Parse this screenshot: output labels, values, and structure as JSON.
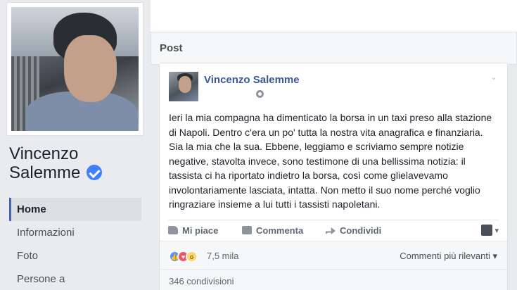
{
  "profile": {
    "name_line1": "Vincenzo",
    "name_line2": "Salemme",
    "verified_icon": "verified-badge-icon"
  },
  "nav": [
    {
      "label": "Home",
      "active": true
    },
    {
      "label": "Informazioni"
    },
    {
      "label": "Foto"
    },
    {
      "label": "Persone a"
    }
  ],
  "section": {
    "title": "Post"
  },
  "post": {
    "author": "Vincenzo Salemme",
    "privacy_icon": "globe-icon",
    "text": "Ieri la mia compagna ha dimenticato la borsa in un taxi preso alla stazione di Napoli. Dentro c'era un po' tutta la nostra vita anagrafica e finanziaria. Sia la mia che la sua. Ebbene, leggiamo e scriviamo sempre notizie negative, stavolta invece, sono testimone di una bellissima notizia: il tassista ci ha riportato indietro la borsa, così come glielavevamo involontariamente lasciata, intatta. Non metto il suo nome perché voglio ringraziare insieme a lui tutti i tassisti napoletani.",
    "actions": {
      "like": "Mi piace",
      "comment": "Commenta",
      "share": "Condividi"
    },
    "reactions_count": "7,5 mila",
    "sort_label": "Commenti più rilevanti",
    "shares": "346 condivisioni"
  },
  "colors": {
    "link_blue": "#385898",
    "verified_blue": "#4080ff",
    "page_bg": "#e9ebee"
  }
}
